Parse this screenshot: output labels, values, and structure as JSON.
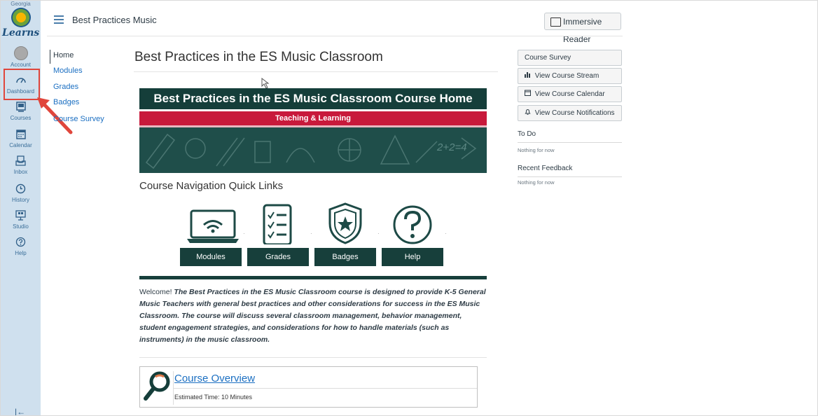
{
  "global_nav": {
    "logo_state": "Georgia",
    "logo_word": "Learns",
    "items": [
      {
        "label": "Account"
      },
      {
        "label": "Dashboard"
      },
      {
        "label": "Courses"
      },
      {
        "label": "Calendar"
      },
      {
        "label": "Inbox"
      },
      {
        "label": "History"
      },
      {
        "label": "Studio"
      },
      {
        "label": "Help"
      }
    ],
    "collapse_glyph": "|←"
  },
  "header": {
    "breadcrumb": "Best Practices Music",
    "immersive_reader": "Immersive Reader"
  },
  "course_nav": {
    "items": [
      {
        "label": "Home",
        "active": true
      },
      {
        "label": "Modules"
      },
      {
        "label": "Grades"
      },
      {
        "label": "Badges"
      },
      {
        "label": "Course Survey"
      }
    ]
  },
  "main": {
    "title": "Best Practices in the ES Music Classroom",
    "banner_title": "Best Practices in the ES Music Classroom Course Home",
    "banner_subtitle": "Teaching & Learning",
    "chalk_text": "2+2=4",
    "quick_links_title": "Course Navigation Quick Links",
    "quick_links": [
      {
        "label": "Modules",
        "icon": "laptop-wifi-icon"
      },
      {
        "label": "Grades",
        "icon": "checklist-icon"
      },
      {
        "label": "Badges",
        "icon": "shield-star-icon"
      },
      {
        "label": "Help",
        "icon": "question-icon"
      }
    ],
    "welcome_lead": "Welcome!",
    "welcome_body": "The Best Practices in the ES Music Classroom course is designed to provide K-5 General Music Teachers with general best practices and other considerations for success in the ES Music Classroom. The course will discuss several classroom management, behavior management, student engagement strategies, and considerations for how to handle materials (such as instruments) in the music classroom.",
    "overview": {
      "title": "Course Overview",
      "time": "Estimated Time: 10 Minutes"
    }
  },
  "sidebar": {
    "buttons": [
      {
        "label": "Course Survey",
        "icon": ""
      },
      {
        "label": "View Course Stream",
        "icon": "bar-chart-icon"
      },
      {
        "label": "View Course Calendar",
        "icon": "calendar-icon"
      },
      {
        "label": "View Course Notifications",
        "icon": "bell-icon"
      }
    ],
    "todo_heading": "To Do",
    "todo_text": "Nothing for now",
    "feedback_heading": "Recent Feedback",
    "feedback_text": "Nothing for now"
  },
  "colors": {
    "nav_bg": "#cfe0ee",
    "banner_dark": "#153e3a",
    "banner_red": "#c8193b",
    "link": "#1b6fc2",
    "highlight": "#e0463c"
  }
}
